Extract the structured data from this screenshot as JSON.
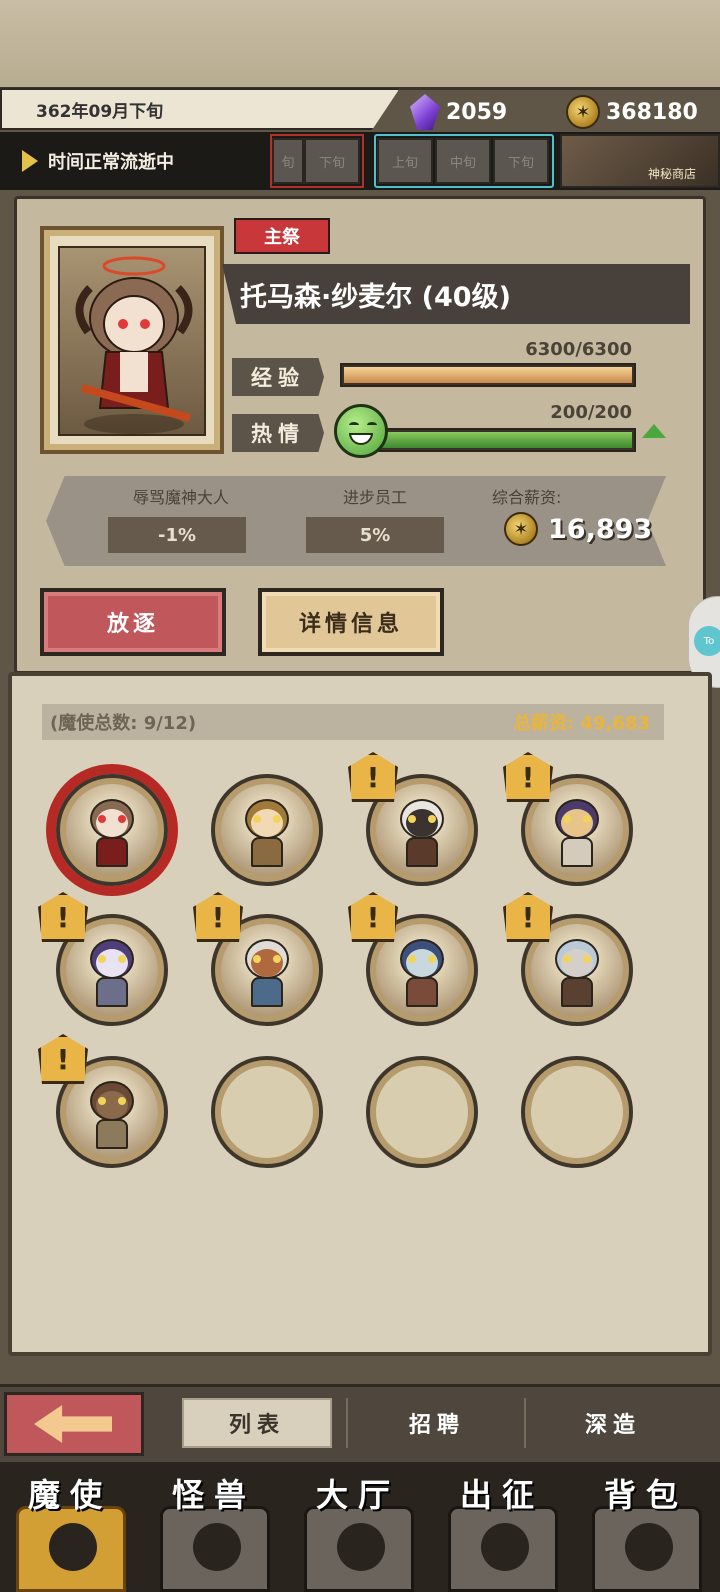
{
  "header": {
    "date": "362年09月下旬",
    "crystals": "2059",
    "coins": "368180",
    "time_status": "时间正常流逝中",
    "prev_segments": [
      "旬",
      "下旬"
    ],
    "segments": [
      "上旬",
      "中旬",
      "下旬"
    ],
    "shop_label": "神秘商店"
  },
  "character": {
    "role_badge": "主祭",
    "name": "托马森·纱麦尔 (40级)",
    "exp_label": "经验",
    "exp_value": "6300/6300",
    "exp_fraction": 1.0,
    "passion_label": "热情",
    "passion_value": "200/200",
    "passion_fraction": 1.0,
    "traits": [
      {
        "name": "辱骂魔神大人",
        "value": "-1%"
      },
      {
        "name": "进步员工",
        "value": "5%"
      }
    ],
    "salary_label": "综合薪资:",
    "salary_value": "16,893"
  },
  "actions": {
    "exile": "放逐",
    "details": "详情信息"
  },
  "side_tab": {
    "label": "To"
  },
  "roster": {
    "count_label": "(魔使总数: 9/12)",
    "total_salary_label": "总薪资: 49,683",
    "slots": [
      {
        "filled": true,
        "selected": true,
        "alert": false,
        "hair": "#8a6a52",
        "skin": "#f2e0d0",
        "outfit": "#7a1d1d",
        "eyes": "#e03a3a"
      },
      {
        "filled": true,
        "selected": false,
        "alert": false,
        "hair": "#a07a38",
        "skin": "#f1d9b5",
        "outfit": "#8a6a40",
        "eyes": "#f2d45b"
      },
      {
        "filled": true,
        "selected": false,
        "alert": true,
        "hair": "#e9e6df",
        "skin": "#3a3330",
        "outfit": "#5a3a2a",
        "eyes": "#f2d45b"
      },
      {
        "filled": true,
        "selected": false,
        "alert": true,
        "hair": "#4b3a6a",
        "skin": "#e6c48a",
        "outfit": "#d4cbbd",
        "eyes": "#f2d45b"
      },
      {
        "filled": true,
        "selected": false,
        "alert": true,
        "hair": "#4e3f7a",
        "skin": "#e9e2f2",
        "outfit": "#6b6f8a",
        "eyes": "#f2d45b"
      },
      {
        "filled": true,
        "selected": false,
        "alert": true,
        "hair": "#e0ddd6",
        "skin": "#b0683f",
        "outfit": "#4c6a8a",
        "eyes": "#f2d45b"
      },
      {
        "filled": true,
        "selected": false,
        "alert": true,
        "hair": "#3d4f7a",
        "skin": "#c9d8dc",
        "outfit": "#7a4a3a",
        "eyes": "#f2d45b"
      },
      {
        "filled": true,
        "selected": false,
        "alert": true,
        "hair": "#b9c9d6",
        "skin": "#d4cfc8",
        "outfit": "#5a4030",
        "eyes": "#f2d45b"
      },
      {
        "filled": true,
        "selected": false,
        "alert": true,
        "hair": "#6a4a36",
        "skin": "#8a6a4a",
        "outfit": "#8d7a5a",
        "eyes": "#f2d45b"
      },
      {
        "filled": false
      },
      {
        "filled": false
      },
      {
        "filled": false
      }
    ]
  },
  "sub_tabs": [
    "列表",
    "招聘",
    "深造"
  ],
  "nav": [
    "魔使",
    "怪兽",
    "大厅",
    "出征",
    "背包"
  ],
  "colors": {
    "accent_red": "#c0585b",
    "gold": "#e9b53d",
    "panel": "#d9d0bb"
  }
}
